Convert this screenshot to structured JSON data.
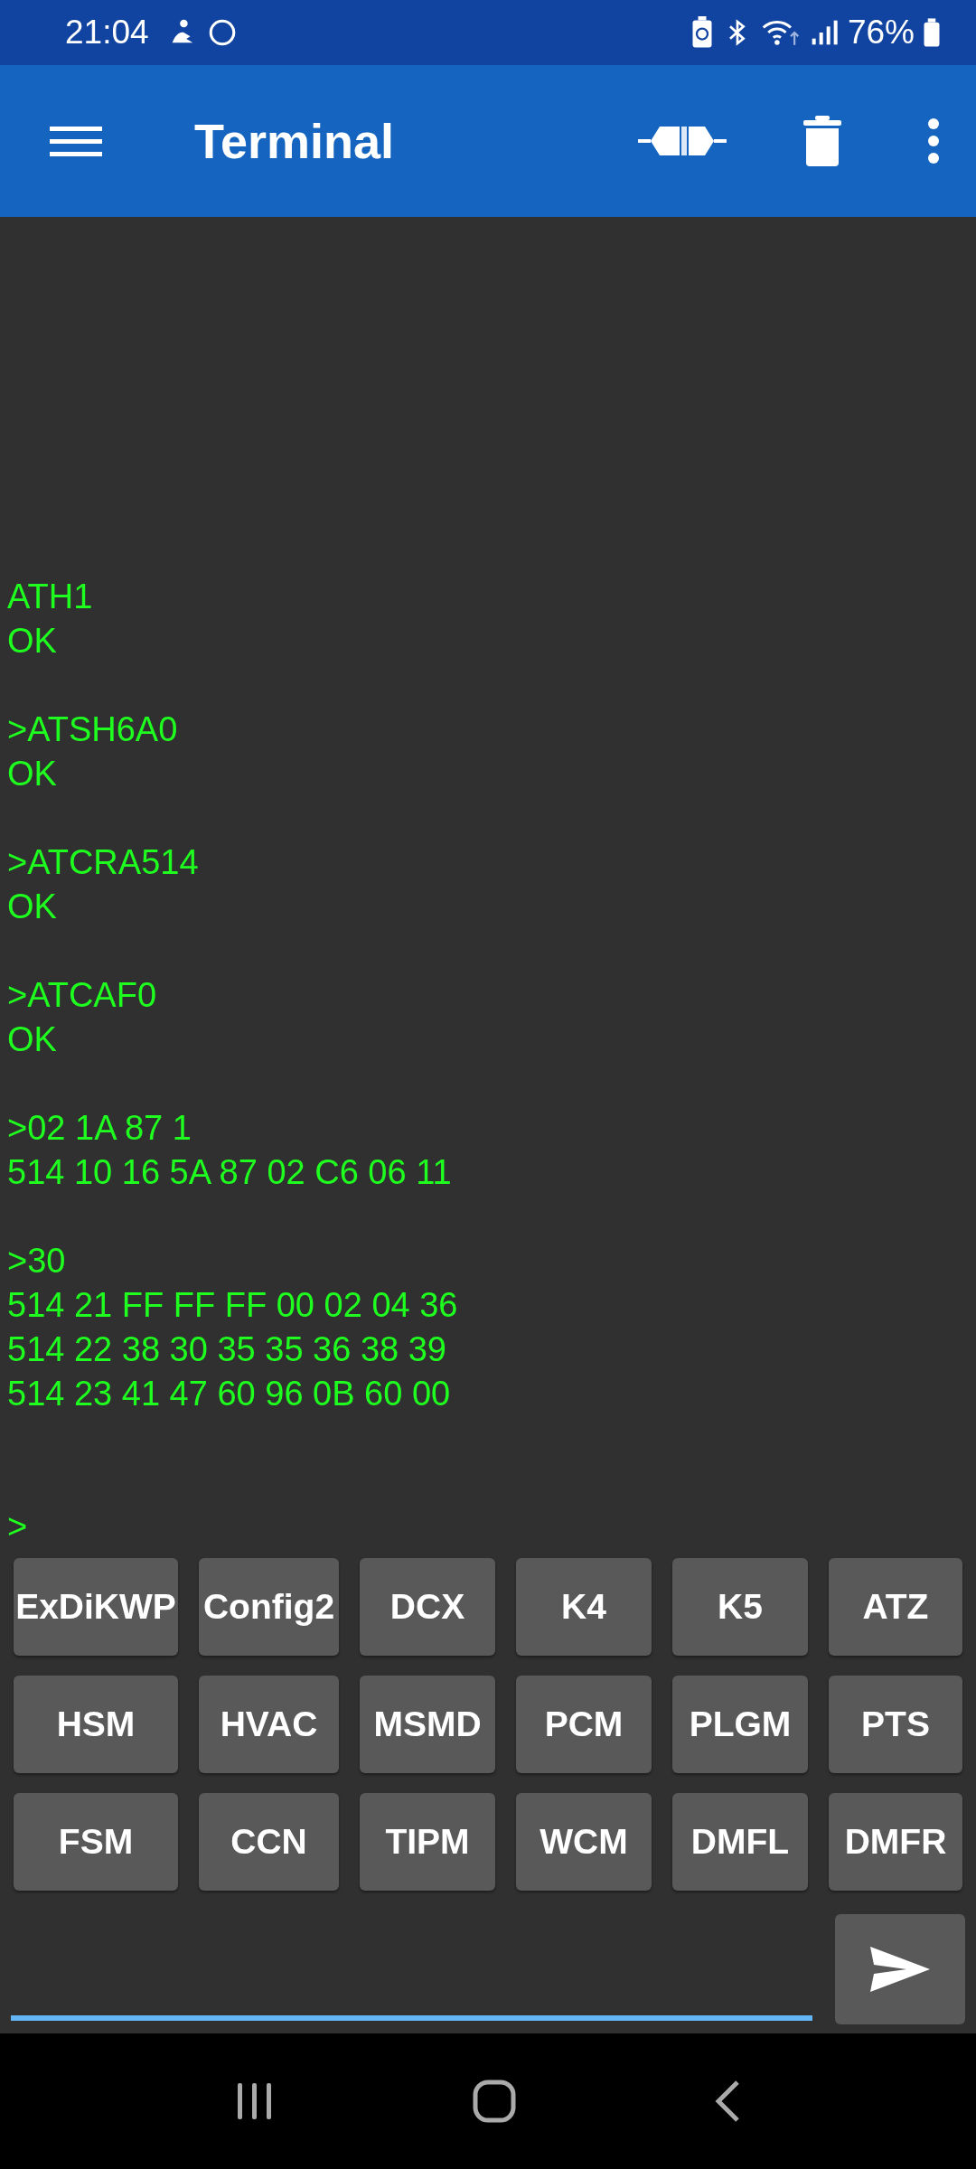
{
  "status_bar": {
    "time": "21:04",
    "battery": "76%"
  },
  "app_bar": {
    "title": "Terminal"
  },
  "terminal": {
    "blocks": [
      {
        "lines": [
          "ATH1",
          "OK"
        ]
      },
      {
        "lines": [
          ">ATSH6A0",
          "OK"
        ]
      },
      {
        "lines": [
          ">ATCRA514",
          "OK"
        ]
      },
      {
        "lines": [
          ">ATCAF0",
          "OK"
        ]
      },
      {
        "lines": [
          ">02 1A 87 1",
          "514 10 16 5A 87 02 C6 06 11"
        ]
      },
      {
        "lines": [
          ">30",
          "514 21 FF FF FF 00 02 04 36",
          "514 22 38 30 35 35 36 38 39",
          "514 23 41 47 60 96 0B 60 00"
        ]
      }
    ],
    "prompt": ">"
  },
  "macro_buttons": [
    [
      "ExDiKWP",
      "Config2",
      "DCX",
      "K4",
      "K5",
      "ATZ"
    ],
    [
      "HSM",
      "HVAC",
      "MSMD",
      "PCM",
      "PLGM",
      "PTS"
    ],
    [
      "FSM",
      "CCN",
      "TIPM",
      "WCM",
      "DMFL",
      "DMFR"
    ]
  ]
}
